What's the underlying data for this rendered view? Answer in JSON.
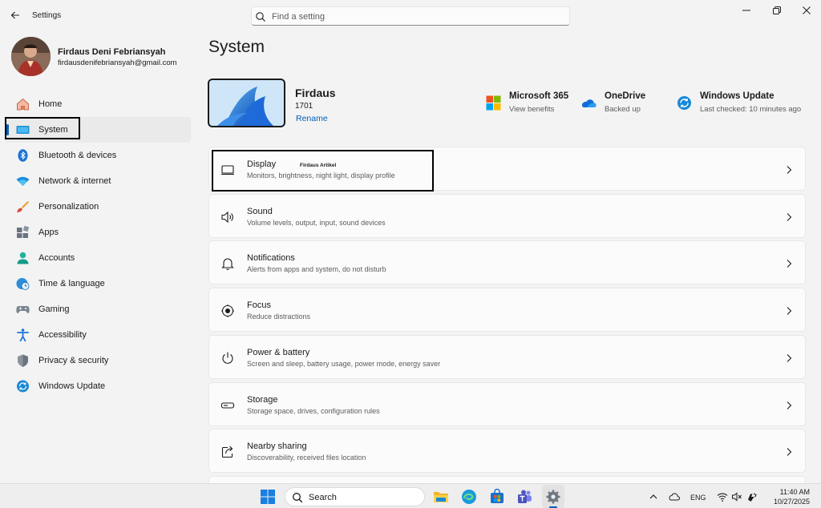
{
  "titlebar": {
    "app_title": "Settings",
    "search_placeholder": "Find a setting"
  },
  "profile": {
    "name": "Firdaus Deni Febriansyah",
    "email": "firdausdenifebriansyah@gmail.com"
  },
  "sidebar": {
    "items": [
      {
        "label": "Home",
        "icon": "home-icon"
      },
      {
        "label": "System",
        "icon": "system-icon",
        "active": true
      },
      {
        "label": "Bluetooth & devices",
        "icon": "bluetooth-icon"
      },
      {
        "label": "Network & internet",
        "icon": "wifi-icon"
      },
      {
        "label": "Personalization",
        "icon": "brush-icon"
      },
      {
        "label": "Apps",
        "icon": "apps-icon"
      },
      {
        "label": "Accounts",
        "icon": "accounts-icon"
      },
      {
        "label": "Time & language",
        "icon": "globe-clock-icon"
      },
      {
        "label": "Gaming",
        "icon": "gamepad-icon"
      },
      {
        "label": "Accessibility",
        "icon": "accessibility-icon"
      },
      {
        "label": "Privacy & security",
        "icon": "shield-icon"
      },
      {
        "label": "Windows Update",
        "icon": "update-icon"
      }
    ]
  },
  "main": {
    "page_title": "System",
    "device": {
      "name": "Firdaus",
      "model": "1701",
      "rename_label": "Rename"
    },
    "quick_links": [
      {
        "title": "Microsoft 365",
        "subtitle": "View benefits",
        "icon": "microsoft-365-icon"
      },
      {
        "title": "OneDrive",
        "subtitle": "Backed up",
        "icon": "onedrive-icon"
      },
      {
        "title": "Windows Update",
        "subtitle": "Last checked: 10 minutes ago",
        "icon": "windows-update-icon"
      }
    ],
    "cards": [
      {
        "title": "Display",
        "subtitle": "Monitors, brightness, night light, display profile",
        "icon": "monitor-icon",
        "watermark": "Firdaus Artikel"
      },
      {
        "title": "Sound",
        "subtitle": "Volume levels, output, input, sound devices",
        "icon": "speaker-icon"
      },
      {
        "title": "Notifications",
        "subtitle": "Alerts from apps and system, do not disturb",
        "icon": "bell-icon"
      },
      {
        "title": "Focus",
        "subtitle": "Reduce distractions",
        "icon": "focus-icon"
      },
      {
        "title": "Power & battery",
        "subtitle": "Screen and sleep, battery usage, power mode, energy saver",
        "icon": "power-icon"
      },
      {
        "title": "Storage",
        "subtitle": "Storage space, drives, configuration rules",
        "icon": "storage-icon"
      },
      {
        "title": "Nearby sharing",
        "subtitle": "Discoverability, received files location",
        "icon": "share-icon"
      }
    ]
  },
  "taskbar": {
    "search_label": "Search",
    "language": "ENG",
    "time": "11:40 AM",
    "date": "10/27/2025"
  },
  "colors": {
    "accent": "#005fb8",
    "background": "#f3f3f3",
    "card": "#fbfbfb"
  }
}
